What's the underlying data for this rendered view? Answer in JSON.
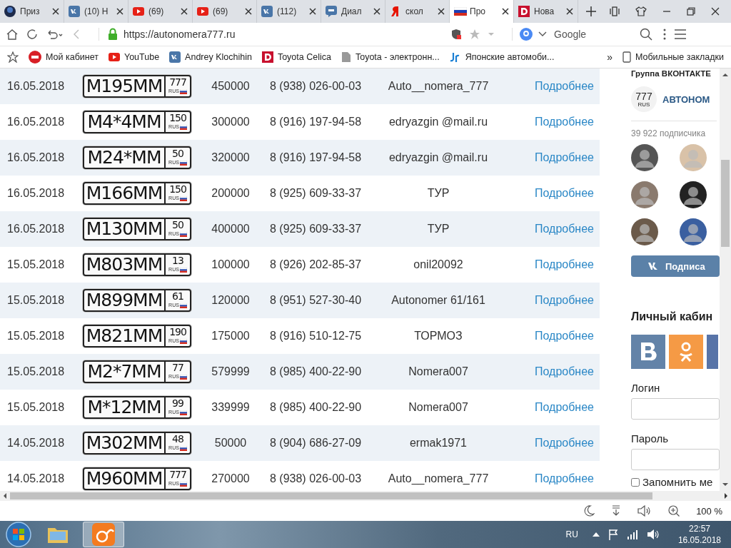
{
  "browser": {
    "tabs": [
      {
        "label": "Приз",
        "kind": "nd",
        "selected": false
      },
      {
        "label": "(10) Н",
        "kind": "vk",
        "selected": false
      },
      {
        "label": "(69)",
        "kind": "youtube",
        "selected": false
      },
      {
        "label": "(69)",
        "kind": "youtube",
        "selected": false
      },
      {
        "label": "(112)",
        "kind": "vk",
        "selected": false
      },
      {
        "label": "Диал",
        "kind": "chat",
        "selected": false
      },
      {
        "label": "скол",
        "kind": "yandex",
        "selected": false
      },
      {
        "label": "Про",
        "kind": "flag",
        "selected": true
      },
      {
        "label": "Нова",
        "kind": "d",
        "selected": false
      }
    ],
    "url": "https://autonomera777.ru",
    "search_placeholder": "Google",
    "bookmarks": [
      {
        "label": "Мой кабинет",
        "kind": "cabinet"
      },
      {
        "label": "YouTube",
        "kind": "youtube"
      },
      {
        "label": "Andrey Klochihin",
        "kind": "vk"
      },
      {
        "label": "Toyota Celica",
        "kind": "d"
      },
      {
        "label": "Toyota - электронн...",
        "kind": "page"
      },
      {
        "label": "Японские автомоби...",
        "kind": "jr"
      }
    ],
    "bookmarks_more": "»",
    "mobile_bookmarks": "Мобильные закладки"
  },
  "listings": [
    {
      "date": "16.05.2018",
      "plate": "М195ММ",
      "region": "777",
      "country": "RUS",
      "price": "450000",
      "phone": "8 (938) 026-00-03",
      "seller": "Auto__nomera_777",
      "link": "Подробнее"
    },
    {
      "date": "16.05.2018",
      "plate": "М4*4ММ",
      "region": "150",
      "country": "RUS",
      "price": "300000",
      "phone": "8 (916) 197-94-58",
      "seller": "edryazgin @mail.ru",
      "link": "Подробнее"
    },
    {
      "date": "16.05.2018",
      "plate": "М24*ММ",
      "region": "50",
      "country": "RUS",
      "price": "320000",
      "phone": "8 (916) 197-94-58",
      "seller": "edryazgin @mail.ru",
      "link": "Подробнее"
    },
    {
      "date": "16.05.2018",
      "plate": "М166ММ",
      "region": "150",
      "country": "RUS",
      "price": "200000",
      "phone": "8 (925) 609-33-37",
      "seller": "ТУР",
      "link": "Подробнее"
    },
    {
      "date": "16.05.2018",
      "plate": "М130ММ",
      "region": "50",
      "country": "RUS",
      "price": "400000",
      "phone": "8 (925) 609-33-37",
      "seller": "ТУР",
      "link": "Подробнее"
    },
    {
      "date": "15.05.2018",
      "plate": "М803ММ",
      "region": "13",
      "country": "RUS",
      "price": "100000",
      "phone": "8 (926) 202-85-37",
      "seller": "onil20092",
      "link": "Подробнее"
    },
    {
      "date": "15.05.2018",
      "plate": "М899ММ",
      "region": "61",
      "country": "RUS",
      "price": "120000",
      "phone": "8 (951) 527-30-40",
      "seller": "Autonomer 61/161",
      "link": "Подробнее"
    },
    {
      "date": "15.05.2018",
      "plate": "М821ММ",
      "region": "190",
      "country": "RUS",
      "price": "175000",
      "phone": "8 (916) 510-12-75",
      "seller": "ТОРМОЗ",
      "link": "Подробнее"
    },
    {
      "date": "15.05.2018",
      "plate": "М2*7ММ",
      "region": "77",
      "country": "RUS",
      "price": "579999",
      "phone": "8 (985) 400-22-90",
      "seller": "Nomera007",
      "link": "Подробнее"
    },
    {
      "date": "15.05.2018",
      "plate": "М*12ММ",
      "region": "99",
      "country": "RUS",
      "price": "339999",
      "phone": "8 (985) 400-22-90",
      "seller": "Nomera007",
      "link": "Подробнее"
    },
    {
      "date": "14.05.2018",
      "plate": "М302ММ",
      "region": "48",
      "country": "RUS",
      "price": "50000",
      "phone": "8 (904) 686-27-09",
      "seller": "ermak1971",
      "link": "Подробнее"
    },
    {
      "date": "14.05.2018",
      "plate": "М960ММ",
      "region": "777",
      "country": "RUS",
      "price": "270000",
      "phone": "8 (938) 026-00-03",
      "seller": "Auto__nomera_777",
      "link": "Подробнее"
    }
  ],
  "sidebar": {
    "group_title": "Группа ВКОНТАКТЕ",
    "logo_number": "777",
    "logo_country": "RUS",
    "group_name": "АВТОНОМ",
    "subscribers": "39 922 подписчика",
    "subscribe_button": "Подписа",
    "cabinet_title": "Личный кабин",
    "login_label": "Логин",
    "password_label": "Пароль",
    "remember_label": "Запомнить ме",
    "remember_checked": false
  },
  "status_bar": {
    "zoom": "100 %"
  },
  "taskbar": {
    "apps": [
      {
        "kind": "explorer",
        "selected": false
      },
      {
        "kind": "uc",
        "selected": true
      }
    ],
    "language": "RU",
    "time": "22:57",
    "date": "16.05.2018"
  }
}
